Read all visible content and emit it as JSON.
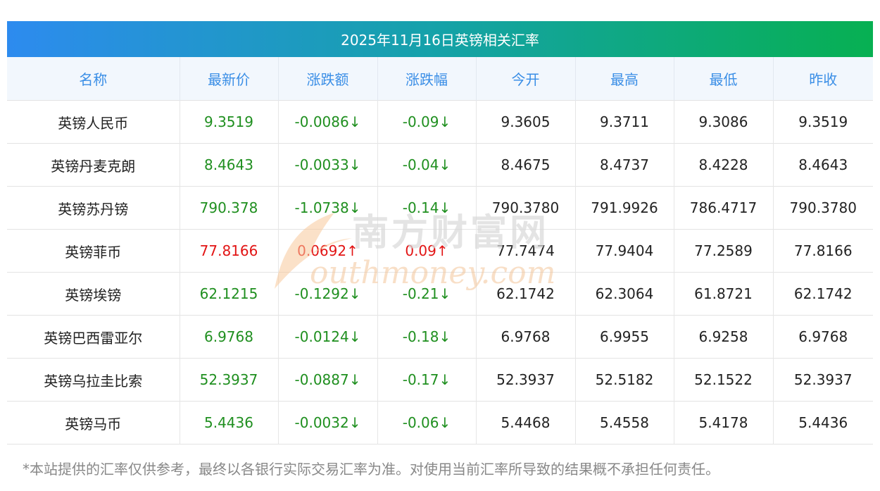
{
  "title": "2025年11月16日英镑相关汇率",
  "columns": [
    "名称",
    "最新价",
    "涨跌额",
    "涨跌幅",
    "今开",
    "最高",
    "最低",
    "昨收"
  ],
  "rows": [
    {
      "name": "英镑人民币",
      "latest": "9.3519",
      "change": "-0.0086↓",
      "change_pct": "-0.09↓",
      "open": "9.3605",
      "high": "9.3711",
      "low": "9.3086",
      "prev_close": "9.3519",
      "trend": "down"
    },
    {
      "name": "英镑丹麦克朗",
      "latest": "8.4643",
      "change": "-0.0033↓",
      "change_pct": "-0.04↓",
      "open": "8.4675",
      "high": "8.4737",
      "low": "8.4228",
      "prev_close": "8.4643",
      "trend": "down"
    },
    {
      "name": "英镑苏丹镑",
      "latest": "790.378",
      "change": "-1.0738↓",
      "change_pct": "-0.14↓",
      "open": "790.3780",
      "high": "791.9926",
      "low": "786.4717",
      "prev_close": "790.3780",
      "trend": "down"
    },
    {
      "name": "英镑菲币",
      "latest": "77.8166",
      "change": "0.0692↑",
      "change_pct": "0.09↑",
      "open": "77.7474",
      "high": "77.9404",
      "low": "77.2589",
      "prev_close": "77.8166",
      "trend": "up"
    },
    {
      "name": "英镑埃镑",
      "latest": "62.1215",
      "change": "-0.1292↓",
      "change_pct": "-0.21↓",
      "open": "62.1742",
      "high": "62.3064",
      "low": "61.8721",
      "prev_close": "62.1742",
      "trend": "down"
    },
    {
      "name": "英镑巴西雷亚尔",
      "latest": "6.9768",
      "change": "-0.0124↓",
      "change_pct": "-0.18↓",
      "open": "6.9768",
      "high": "6.9955",
      "low": "6.9258",
      "prev_close": "6.9768",
      "trend": "down"
    },
    {
      "name": "英镑乌拉圭比索",
      "latest": "52.3937",
      "change": "-0.0887↓",
      "change_pct": "-0.17↓",
      "open": "52.3937",
      "high": "52.5182",
      "low": "52.1522",
      "prev_close": "52.3937",
      "trend": "down"
    },
    {
      "name": "英镑马币",
      "latest": "5.4436",
      "change": "-0.0032↓",
      "change_pct": "-0.06↓",
      "open": "5.4468",
      "high": "5.4558",
      "low": "5.4178",
      "prev_close": "5.4436",
      "trend": "down"
    }
  ],
  "watermark": {
    "cn": "南方财富网",
    "en": "outhmoney.com"
  },
  "footnote": "*本站提供的汇率仅供参考，最终以各银行实际交易汇率为准。对使用当前汇率所导致的结果概不承担任何责任。",
  "colors": {
    "banner_start": "#2d8bef",
    "banner_end": "#07b052",
    "header_text": "#3a8ee6",
    "down": "#1f8f1f",
    "up": "#e21414"
  }
}
